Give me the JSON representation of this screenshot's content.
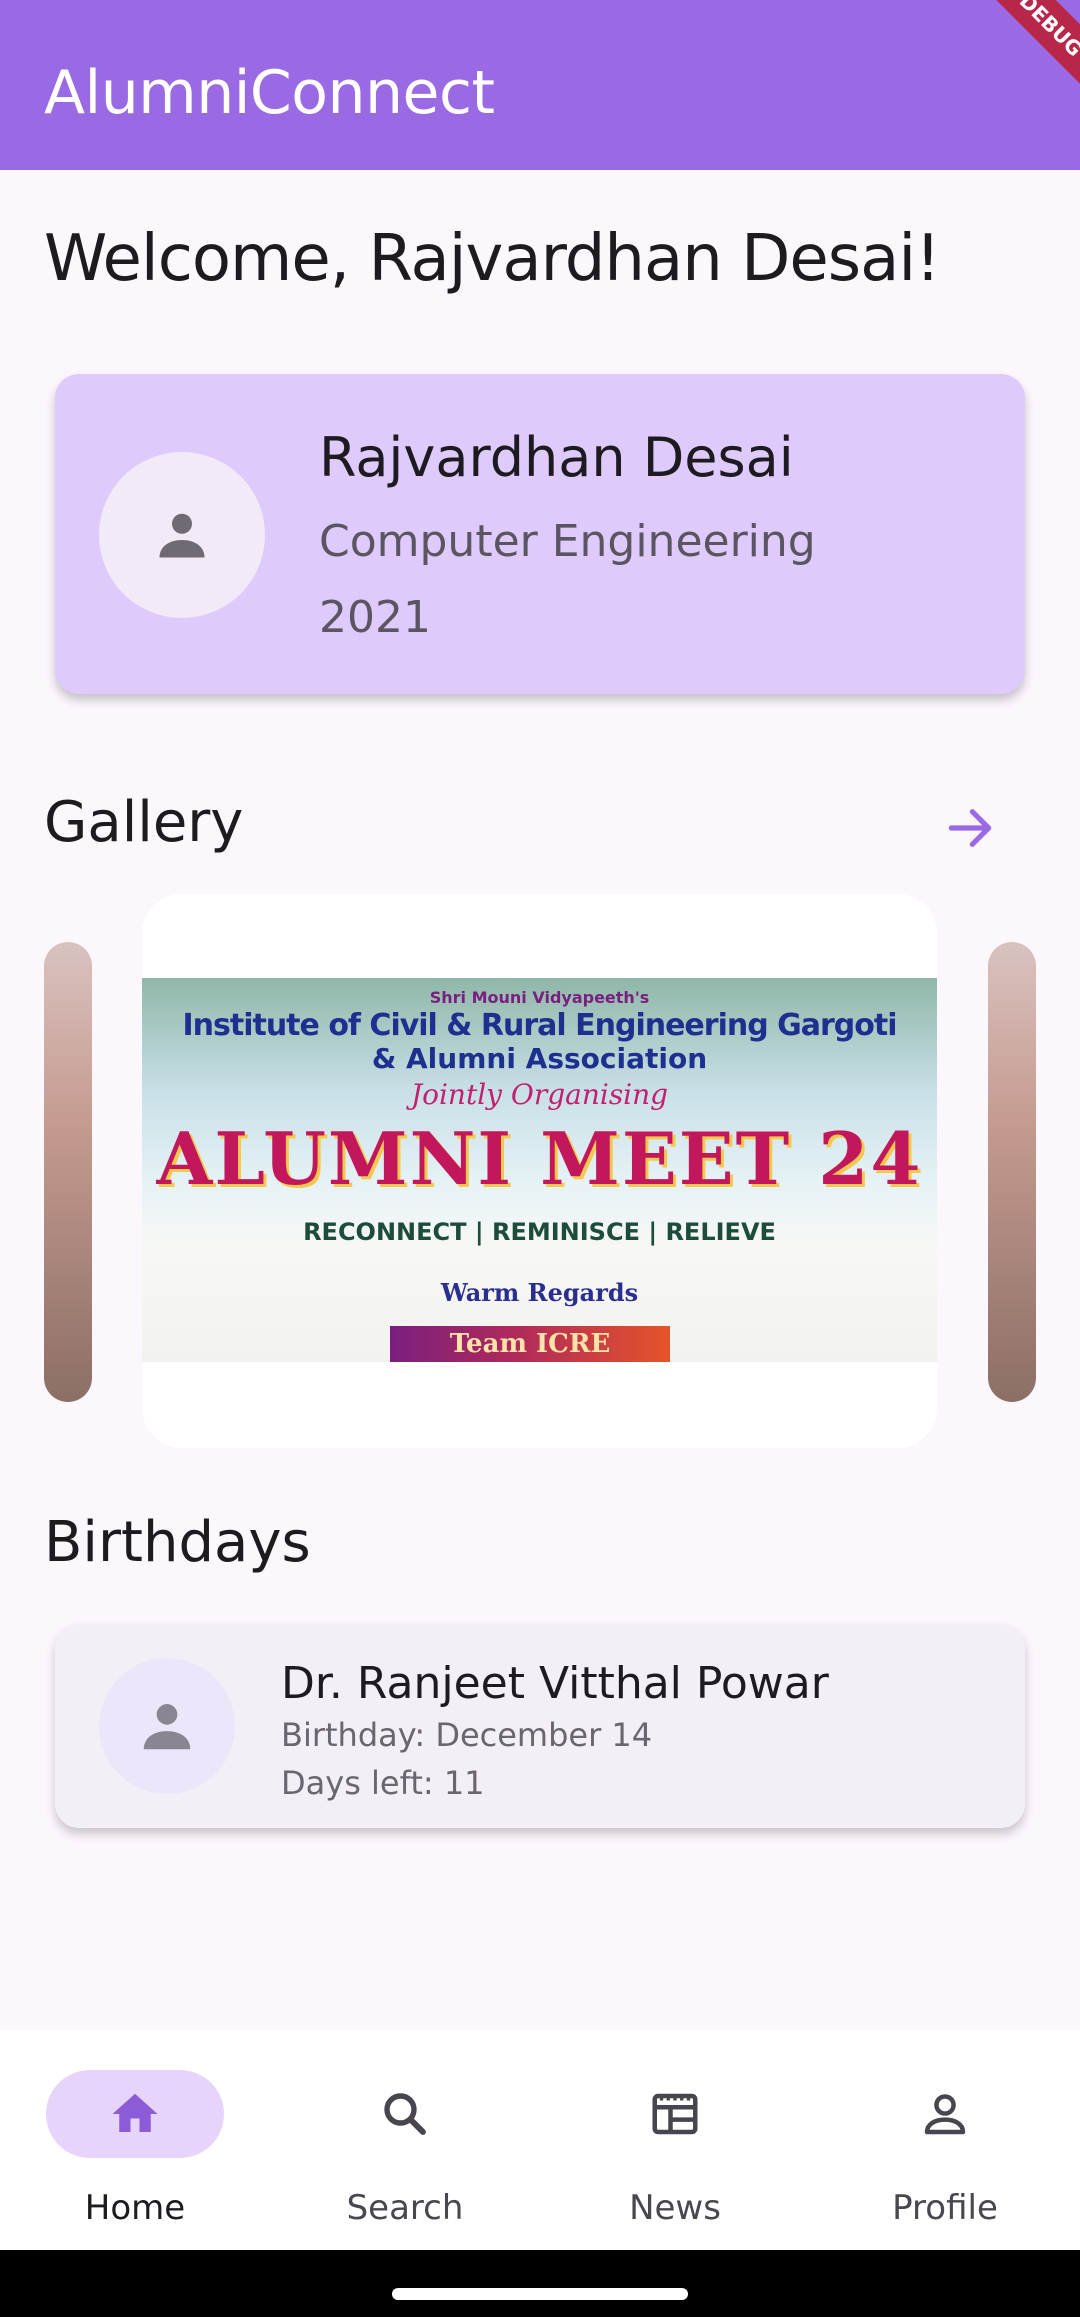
{
  "app": {
    "title": "AlumniConnect",
    "debug_badge": "DEBUG"
  },
  "welcome": "Welcome, Rajvardhan Desai!",
  "profile": {
    "name": "Rajvardhan Desai",
    "department": "Computer Engineering",
    "year": "2021"
  },
  "gallery": {
    "title": "Gallery",
    "banner": {
      "line1": "Shri Mouni Vidyapeeth's",
      "line2": "Institute of Civil & Rural Engineering Gargoti",
      "line3": "& Alumni Association",
      "line4": "Jointly Organising",
      "line5": "ALUMNI MEET 24",
      "line6": "RECONNECT | REMINISCE | RELIEVE",
      "line7": "Warm Regards",
      "line8": "Team ICRE"
    }
  },
  "birthdays": {
    "title": "Birthdays",
    "items": [
      {
        "name": "Dr.  Ranjeet Vitthal Powar",
        "birthday": "Birthday: December 14",
        "days_left": "Days left: 11"
      }
    ]
  },
  "nav": {
    "items": [
      {
        "label": "Home",
        "icon": "home-icon",
        "active": true
      },
      {
        "label": "Search",
        "icon": "search-icon",
        "active": false
      },
      {
        "label": "News",
        "icon": "news-icon",
        "active": false
      },
      {
        "label": "Profile",
        "icon": "person-icon",
        "active": false
      }
    ]
  },
  "colors": {
    "primary": "#9a6ae4",
    "card": "#dfcafc",
    "nav_active": "#e6d4fb"
  }
}
